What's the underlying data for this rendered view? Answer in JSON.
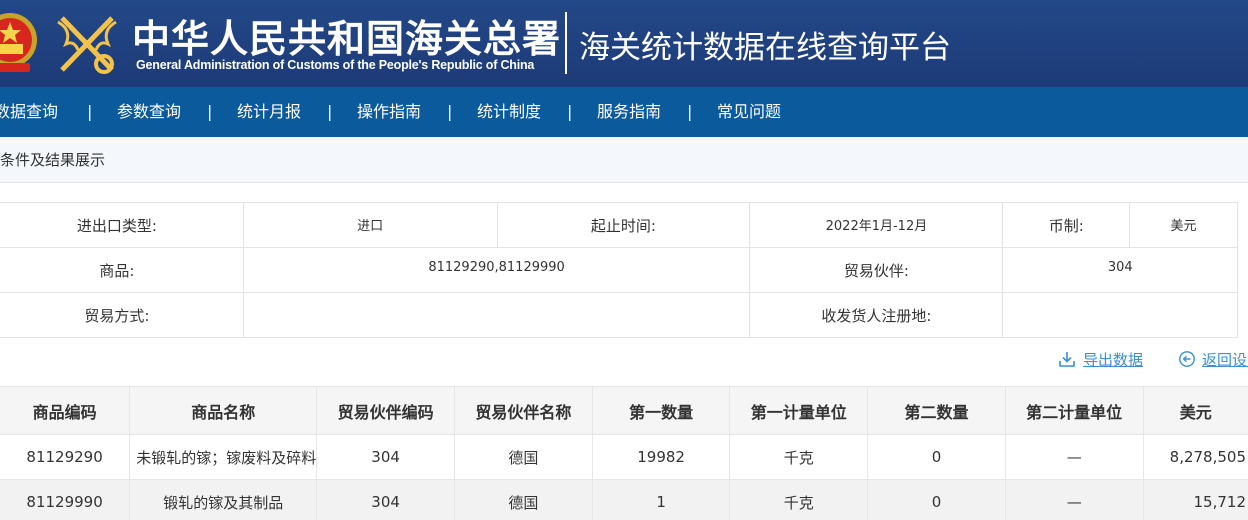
{
  "header": {
    "org_name_cn": "中华人民共和国海关总署",
    "org_name_en": "General Administration of Customs of the People's Republic of China",
    "platform_title": "海关统计数据在线查询平台"
  },
  "nav": {
    "items": [
      "数据查询",
      "参数查询",
      "统计月报",
      "操作指南",
      "统计制度",
      "服务指南",
      "常见问题"
    ],
    "separator": "|"
  },
  "section": {
    "title": "查询条件及结果展示"
  },
  "criteria": {
    "trade_type_label": "进出口类型:",
    "trade_type_value": "进口",
    "period_label": "起止时间:",
    "period_value": "2022年1月-12月",
    "currency_label": "币制:",
    "currency_value": "美元",
    "commodity_label": "商品:",
    "commodity_value": "81129290,81129990",
    "partner_label": "贸易伙伴:",
    "partner_value": "304",
    "trade_mode_label": "贸易方式:",
    "trade_mode_value": "",
    "consignee_label": "收发货人注册地:",
    "consignee_value": ""
  },
  "actions": {
    "export_label": "导出数据",
    "back_label": "返回设置"
  },
  "results": {
    "columns": [
      "商品编码",
      "商品名称",
      "贸易伙伴编码",
      "贸易伙伴名称",
      "第一数量",
      "第一计量单位",
      "第二数量",
      "第二计量单位",
      "美元"
    ],
    "rows": [
      [
        "81129290",
        "未锻轧的镓；镓废料及碎料",
        "304",
        "德国",
        "19982",
        "千克",
        "0",
        "—",
        "8,278,505"
      ],
      [
        "81129990",
        "锻轧的镓及其制品",
        "304",
        "德国",
        "1",
        "千克",
        "0",
        "—",
        "15,712"
      ]
    ]
  },
  "colors": {
    "header_bg": "#1f3f7d",
    "nav_bg": "#0b5a9c",
    "link": "#3a8fd6"
  }
}
